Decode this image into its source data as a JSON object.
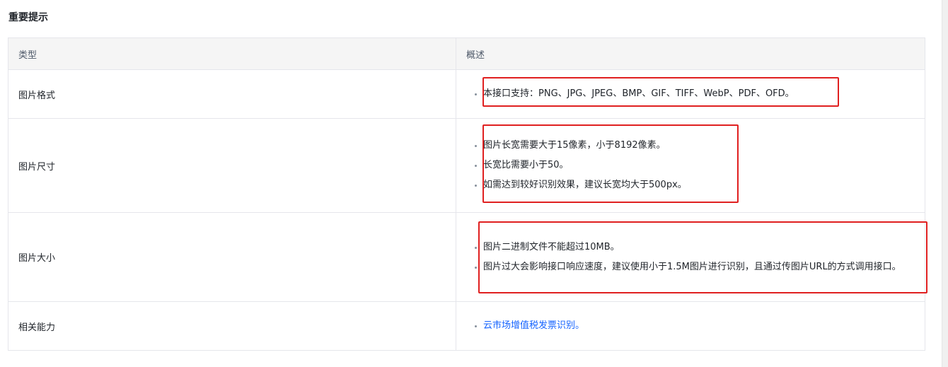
{
  "section": {
    "title": "重要提示"
  },
  "table": {
    "headers": {
      "type": "类型",
      "description": "概述"
    },
    "rows": [
      {
        "type": "图片格式",
        "items": [
          "本接口支持：PNG、JPG、JPEG、BMP、GIF、TIFF、WebP、PDF、OFD。"
        ]
      },
      {
        "type": "图片尺寸",
        "items": [
          "图片长宽需要大于15像素，小于8192像素。",
          "长宽比需要小于50。",
          "如需达到较好识别效果，建议长宽均大于500px。"
        ]
      },
      {
        "type": "图片大小",
        "items": [
          "图片二进制文件不能超过10MB。",
          "图片过大会影响接口响应速度，建议使用小于1.5M图片进行识别，且通过传图片URL的方式调用接口。"
        ]
      },
      {
        "type": "相关能力",
        "link": "云市场增值税发票识别。"
      }
    ]
  },
  "colors": {
    "highlight": "#e02020",
    "link": "#1664ff",
    "header_bg": "#f5f5f5",
    "border": "#e5e6eb"
  }
}
